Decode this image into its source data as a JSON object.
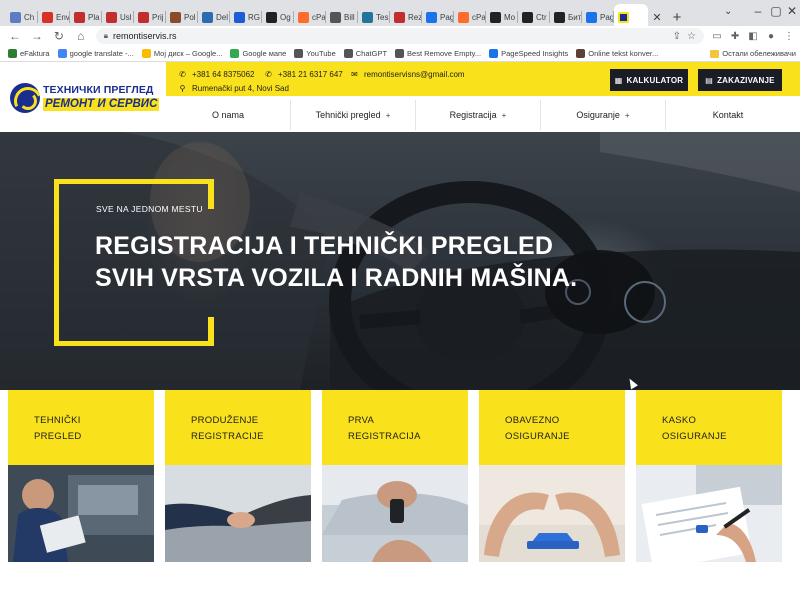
{
  "browser": {
    "tabs": [
      {
        "label": "Ch",
        "color": "#5e7cc4"
      },
      {
        "label": "Env",
        "color": "#d93025"
      },
      {
        "label": "Pla",
        "color": "#c22d2d"
      },
      {
        "label": "Usl",
        "color": "#c22d2d"
      },
      {
        "label": "Prij",
        "color": "#c22d2d"
      },
      {
        "label": "Pol",
        "color": "#8a4b2a"
      },
      {
        "label": "Del",
        "color": "#2b6cb0"
      },
      {
        "label": "RG",
        "color": "#1e5bd6"
      },
      {
        "label": "Og",
        "color": "#222222"
      },
      {
        "label": "cPa",
        "color": "#ff6c2c"
      },
      {
        "label": "Bill",
        "color": "#555555"
      },
      {
        "label": "Tes",
        "color": "#21759b"
      },
      {
        "label": "Rez",
        "color": "#c22d2d"
      },
      {
        "label": "Pag",
        "color": "#1a73e8"
      },
      {
        "label": "cPa",
        "color": "#ff6c2c"
      },
      {
        "label": "Mo",
        "color": "#222222"
      },
      {
        "label": "Ctr",
        "color": "#222222"
      },
      {
        "label": "Бит",
        "color": "#222222"
      },
      {
        "label": "Pag",
        "color": "#1a73e8"
      }
    ],
    "active_tab": {
      "label": "",
      "color": "#1b2e8f"
    },
    "url": "remontiservis.rs",
    "bookmarks": [
      {
        "label": "eFaktura",
        "color": "#2e7d32"
      },
      {
        "label": "google translate -...",
        "color": "#4285f4"
      },
      {
        "label": "Мој диск – Google...",
        "color": "#fbbc04"
      },
      {
        "label": "Google мапе",
        "color": "#34a853"
      },
      {
        "label": "YouTube",
        "color": "#555555"
      },
      {
        "label": "ChatGPT",
        "color": "#555555"
      },
      {
        "label": "Best Remove Empty...",
        "color": "#555555"
      },
      {
        "label": "PageSpeed Insights",
        "color": "#1a73e8"
      },
      {
        "label": "Online tekst konver...",
        "color": "#5d4037"
      }
    ],
    "other_bookmarks": "Остали обележивачи"
  },
  "site": {
    "logo_top": "ТЕХНИЧКИ ПРЕГЛЕД",
    "logo_bottom": "РЕМОНТ И СЕРВИС",
    "phone1": "+381 64 8375062",
    "phone2": "+381 21 6317 647",
    "email": "remontiservisns@gmail.com",
    "address": "Rumenački put 4, Novi Sad",
    "btn_calculator": "KALKULATOR",
    "btn_booking": "ZAKAZIVANJE",
    "nav": [
      {
        "label": "O nama",
        "has_sub": false
      },
      {
        "label": "Tehnički pregled",
        "has_sub": true
      },
      {
        "label": "Registracija",
        "has_sub": true
      },
      {
        "label": "Osiguranje",
        "has_sub": true
      },
      {
        "label": "Kontakt",
        "has_sub": false
      }
    ],
    "nav_plus": "+",
    "hero": {
      "eyebrow": "SVE NA JEDNOM MESTU",
      "line1": "REGISTRACIJA I TEHNIČKI PREGLED",
      "line2": "SVIH VRSTA VOZILA I RADNIH MAŠINA."
    },
    "cards": [
      {
        "line1": "TEHNIČKI",
        "line2": "PREGLED"
      },
      {
        "line1": "PRODUŽENJE",
        "line2": "REGISTRACIJE"
      },
      {
        "line1": "PRVA",
        "line2": "REGISTRACIJA"
      },
      {
        "line1": "OBAVEZNO",
        "line2": "OSIGURANJE"
      },
      {
        "line1": "KASKO",
        "line2": "OSIGURANJE"
      }
    ],
    "colors": {
      "accent": "#f9e21b",
      "dark": "#1a1d24",
      "brand": "#1b2e8f"
    }
  }
}
